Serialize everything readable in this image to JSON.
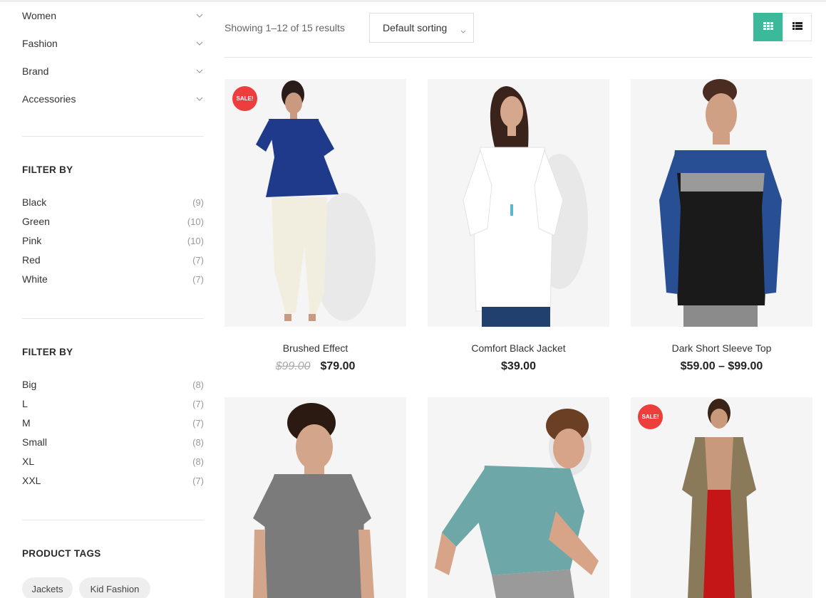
{
  "sidebar": {
    "categories": [
      {
        "label": "Women"
      },
      {
        "label": "Fashion"
      },
      {
        "label": "Brand"
      },
      {
        "label": "Accessories"
      }
    ],
    "color_filter": {
      "title": "FILTER BY",
      "items": [
        {
          "label": "Black",
          "count": "(9)"
        },
        {
          "label": "Green",
          "count": "(10)"
        },
        {
          "label": "Pink",
          "count": "(10)"
        },
        {
          "label": "Red",
          "count": "(7)"
        },
        {
          "label": "White",
          "count": "(7)"
        }
      ]
    },
    "size_filter": {
      "title": "FILTER BY",
      "items": [
        {
          "label": "Big",
          "count": "(8)"
        },
        {
          "label": "L",
          "count": "(7)"
        },
        {
          "label": "M",
          "count": "(7)"
        },
        {
          "label": "Small",
          "count": "(8)"
        },
        {
          "label": "XL",
          "count": "(8)"
        },
        {
          "label": "XXL",
          "count": "(7)"
        }
      ]
    },
    "tags": {
      "title": "PRODUCT TAGS",
      "items": [
        "Jackets",
        "Kid Fashion"
      ]
    }
  },
  "toolbar": {
    "result_count": "Showing 1–12 of 15 results",
    "sorting": "Default sorting",
    "view_active": "grid",
    "accent_color": "#3cb89b"
  },
  "products": [
    {
      "title": "Brushed Effect",
      "old_price": "$99.00",
      "price": "$79.00",
      "sale": true,
      "sale_label": "SALE!"
    },
    {
      "title": "Comfort Black Jacket",
      "price": "$39.00",
      "sale": false
    },
    {
      "title": "Dark Short Sleeve Top",
      "price": "$59.00 – $99.00",
      "sale": false
    },
    {
      "sale": false
    },
    {
      "sale": false
    },
    {
      "sale": true,
      "sale_label": "SALE!"
    }
  ],
  "colors": {
    "sale_badge": "#ed3d3d",
    "thumb_bg": "#f4f4f4"
  }
}
